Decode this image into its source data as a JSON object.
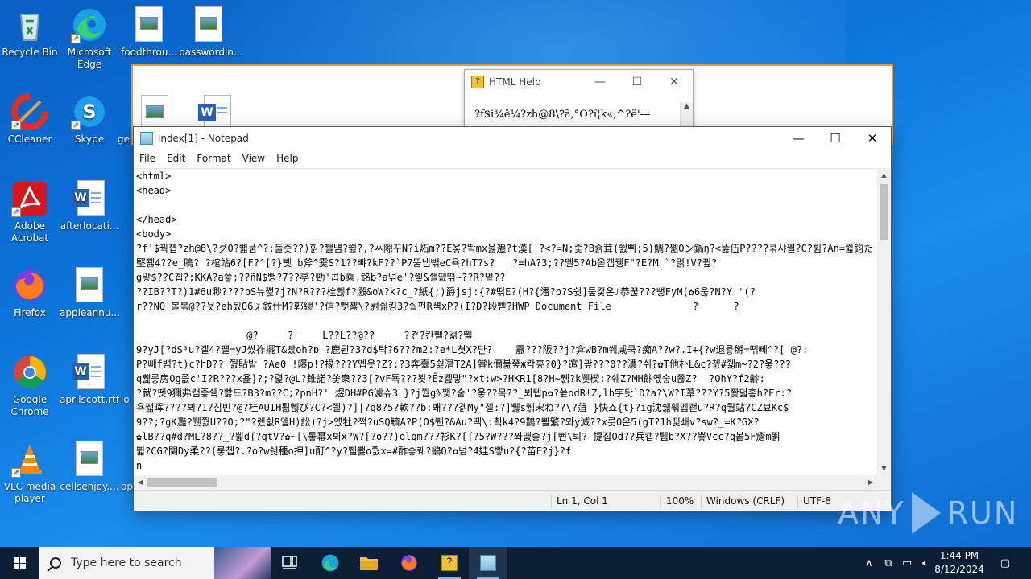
{
  "desktop": {
    "icons": [
      {
        "label": "Recycle Bin"
      },
      {
        "label": "Microsoft Edge"
      },
      {
        "label": "foodthrou..."
      },
      {
        "label": "passwordin..."
      },
      {
        "label": "CCleaner"
      },
      {
        "label": "Skype"
      },
      {
        "label": "Adobe Acrobat"
      },
      {
        "label": "afterlocati..."
      },
      {
        "label": "Firefox"
      },
      {
        "label": "appleannu..."
      },
      {
        "label": "Google Chrome"
      },
      {
        "label": "aprilscott.rtf"
      },
      {
        "label": "VLC media player"
      },
      {
        "label": "cellsenjoy...."
      }
    ],
    "partial_labels": [
      "ge",
      "lo",
      "op"
    ]
  },
  "help_window": {
    "title": "HTML Help",
    "body_text": "?f$i¾ê¼?zh@8\\?ã,°O?ï¦k«,^?ë'—",
    "controls": [
      "—",
      "☐",
      "✕"
    ]
  },
  "notepad": {
    "title": "index[1] - Notepad",
    "menu": [
      "File",
      "Edit",
      "Format",
      "View",
      "Help"
    ],
    "lines": [
      "<html>",
      "<head>",
      "",
      "</head>",
      "<body>",
      "?f'$꿕쟵?zh@8\\?グO?뼓품^?:둘즛??)힑?뾀냼?쭳?,?ㅆ隙꾸N?i炻m??E욯?똭mx욿遷?t漢[|?<?=N;좇?B쥵茸(쭰쀠;5)鯛?쩲Oン鍋ŋ?<뚫伍P????쿢샤쪌?C?륌?An=쮧鈞た w졧酉B?榛돀?Fs뺌앣뤣Y?얏뗪?XwO?",
      "堅뾇4??e_瞗? ?棺站6?[F?^[?}뻿 b斧^霙S?1??뺘?kF??`P7뚬냅뺶eC욕?hT?s?   ?=hA?3;??뗄5?Ab옫겝뀅F\"?E?M `?멁!V?뀦?",
      "g맣$??C곕?;KKA?a쓯;??ñN$뻥?7??亭?勁'콥b乘,銘b?a넊e'?쮷&좰땞뗚~??R?멑??",
      "??IB??T?)1#6u渺????bS뉴쪑?j?N?R???栓쀊f?瀫&oW?k?c_?紙{;)爵jsj:{?#뗚E?(H?{潘?p?S쉿]둪캋온♪恭꾽???뻥FyM(✿6욶?N?Y '(?",
      "r??NQ`볼볶@??욧?eh됬Q6ぇ鈫仕M?郭繆'?信?뾋졣\\?尉쉶킹3?쉌펀R섁xP?(I?D?段뻳?HWP Document File              ?      ?",
      "",
      "                   @?     ?`    L??L??@??     ?ぞ?칸쀌?걺?쀌",
      "9?yJ[?dS³u?겔4?퍨=yJ쌌祚擺T&빴oh?ɒ ?鹿튄?3?d$탁?6???m2:?e*L쳣X?먇?    霢???阪??j?弇wB?m쒜咸쿡?痴A??w?.I+{?w退윻掰=뗶뼤^?[ @?:",
      "P?뻬f뱸?t)c?hD?? 쭰貼밭 ?Ae0 !曝p!?掾???Y뗍옷?Z?:?3奔臺5쉁潛T2A]甞k儞뵲쭢ж칵亮?0}?逭]괖???0??濃?쉬?✿T他朴L&c?쳀#줿m~?2?욯???",
      "q쀒뤃房Og쯦c'I?R???x욡]?;?렱?@L?錐諾?쏯衆??3[?vF됵???뵛?Ēz콆맣\"?xt:w>?HKR1[8?H~쀍?k뛧楔:?쉐Z?MH飰옋숳u쬲Z?  ?OhY?f2齡:",
      "?就?뗏9獮弗캠좋쉑?빯뜨?B3?m??C;?pnH?' 煜DH#PG濾슈3 }?j쭵g%쨏?숱'?욯??목??_뵈텝p✿?쓮odR!Z,lh宇돳`D?a?\\W?I葦???Y?5쫮덟흥h?Fr:?",
      "욕쨃晖????뵈?1?짐빈?@?桂AUIH뢺쀊ぴ?C?<쯸)?]|?q8?5?軟??b:봬???곍My\"젤:?]쀓s쀍宋ね??\\?菹 }快죠{t}?ig沈쉛훾멥쾓u?R?q뭘站?CZ뵤Kc$",
      "9??;?gK灩?뛧쭰U??O;?\"?렜쉾R얠H)訟)?j>얬牡?쪅?uSQ鱭A?P(O$쀈?&Au?뗔\\:쵝k4?9鵲?뽤繁?뫄y減??x릇O온5(gT?1h뀣쇄v?sw?_=K?GX?",
      "✿lB??q#d?ML?8??_?쀭d{?qtV?✿~[\\롷幂x뵈x?W?[?o??)olqm??7衫K?[{?5?W???쫘먨숳?j[뻔\\퇴? 提잡Od??兵캡?뤰b?X??쁗Vcc?q봍5F瘡m뙭",
      "쀫?CG?関Dy柔??(뤃쳅?.?o?w쉣種o押]u酊^?y?쀌뾇o쭰x=#酢솧퀘?鶲Q?✿넘?4娃S빻u?{?苗E?j}?f",
      "n"
    ],
    "status": {
      "position": "Ln 1, Col 1",
      "zoom": "100%",
      "line_ending": "Windows (CRLF)",
      "encoding": "UTF-8"
    }
  },
  "watermark": {
    "left": "ANY",
    "right": "RUN"
  },
  "taskbar": {
    "search_placeholder": "Type here to search",
    "time": "1:44 PM",
    "date": "8/12/2024"
  },
  "colors": {
    "desktop_accent": "#0c74da",
    "taskbar_bg": "#0b1e33",
    "window_border_highlight": "#e8953a"
  }
}
